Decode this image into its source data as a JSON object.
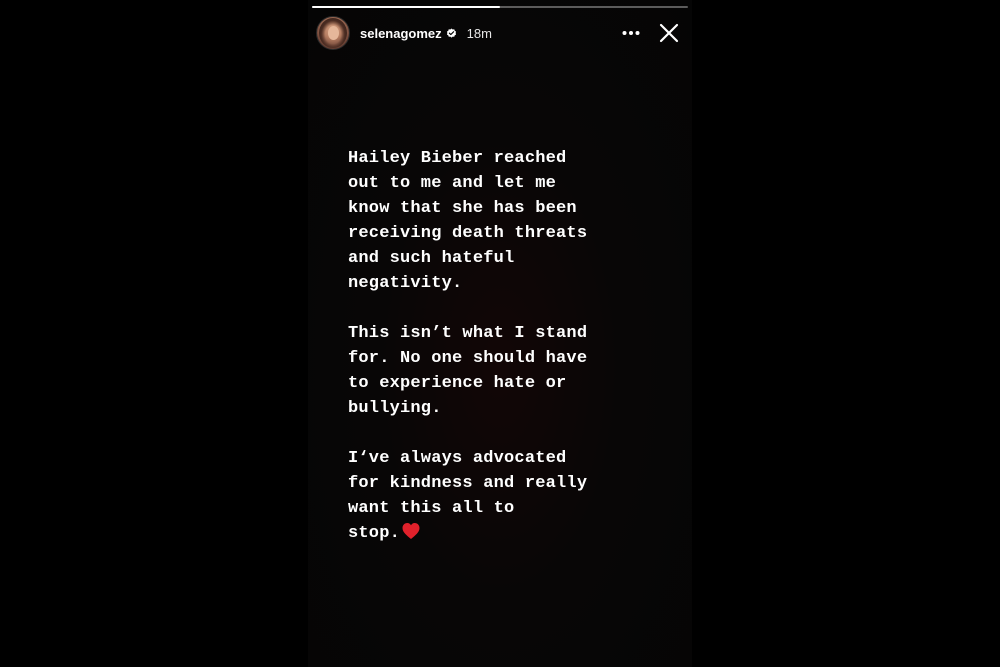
{
  "story": {
    "progress_fraction": 0.5,
    "accent_color": "#ffffff"
  },
  "header": {
    "username": "selenagomez",
    "time": "18m",
    "verified_icon": "verified-badge-icon",
    "more_icon": "more-horizontal-icon",
    "close_icon": "close-icon"
  },
  "content": {
    "paragraphs": [
      {
        "lines": [
          "Hailey Bieber reached",
          "out to me and let me",
          "know that she has been",
          "receiving death threats",
          "and such hateful",
          "negativity."
        ]
      },
      {
        "lines": [
          "This isn’t what I stand",
          "for. No one should have",
          "to experience hate or",
          "bullying."
        ]
      },
      {
        "lines": [
          "I‘ve always advocated",
          "for kindness and really",
          "want this all to",
          "stop."
        ]
      }
    ],
    "heart_icon": "red-heart-icon",
    "heart_color": "#e0212b"
  }
}
